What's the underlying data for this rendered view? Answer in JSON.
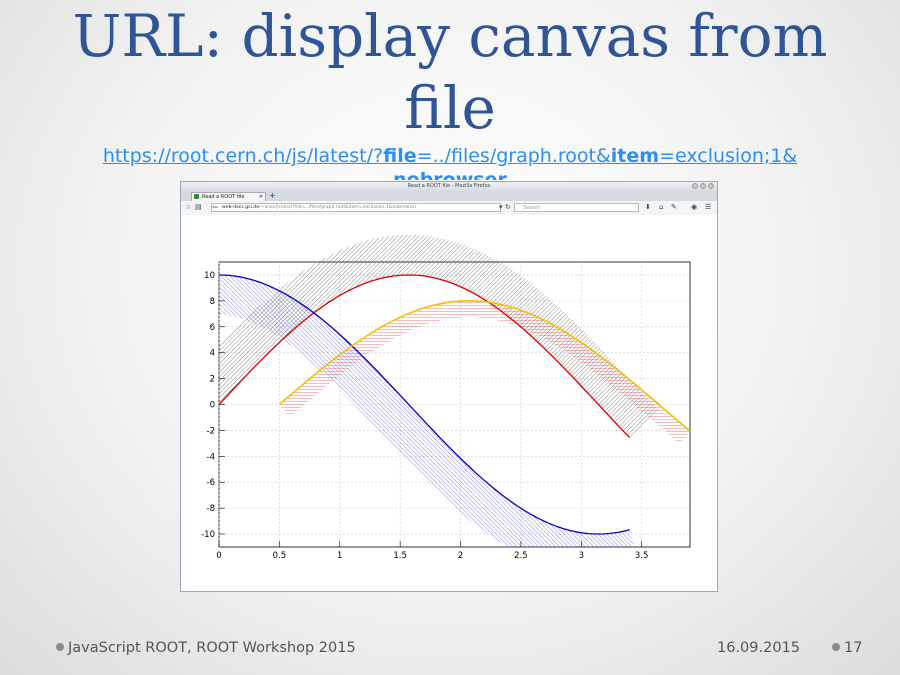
{
  "slide": {
    "title": "URL: display canvas from file",
    "url": {
      "prefix": "https://root.cern.ch/js/latest/?",
      "key1": "file",
      "val1": "=../files/graph.root&",
      "key2": "item",
      "val2": "=exclusion;1&",
      "key3": "nobrowser"
    },
    "footer_left": "JavaScript ROOT, ROOT Workshop 2015",
    "footer_date": "16.09.2015",
    "page_number": "17"
  },
  "browser": {
    "window_title": "Read a ROOT file - Mozilla Firefox",
    "tab_label": "Read a ROOT file",
    "url_host": "web-docs.gsi.de",
    "url_path": "/~linev/js/dev/?file=../files/graph.root&item=exclusion;1&nobrowser",
    "search_placeholder": "Search"
  },
  "colors": {
    "title": "#2f5597",
    "link": "#2a8ff2",
    "curve_red": "#dd0000",
    "curve_blue": "#0000cc",
    "curve_yellow": "#f0c000",
    "hatch_red": "#ee3333",
    "hatch_gray": "#555555",
    "hatch_blue": "#5555dd"
  },
  "chart_data": {
    "type": "line",
    "xlim": [
      0,
      3.9
    ],
    "ylim": [
      -11,
      11
    ],
    "x_ticks": [
      0,
      0.5,
      1,
      1.5,
      2,
      2.5,
      3,
      3.5
    ],
    "y_ticks": [
      -10,
      -8,
      -6,
      -4,
      -2,
      0,
      2,
      4,
      6,
      8,
      10
    ],
    "grid": true,
    "series": [
      {
        "function": "10*sin(x)",
        "x_range": [
          0,
          3.4
        ],
        "color": "red",
        "band": "gray hatched, above curve"
      },
      {
        "function": "10*cos(x)",
        "x_range": [
          0,
          3.4
        ],
        "color": "blue",
        "band": "blue hatched, below curve"
      },
      {
        "function": "8*sin(x-0.5)",
        "x_range": [
          0.5,
          3.9
        ],
        "color": "yellow",
        "band": "red hatched, below curve"
      }
    ]
  }
}
